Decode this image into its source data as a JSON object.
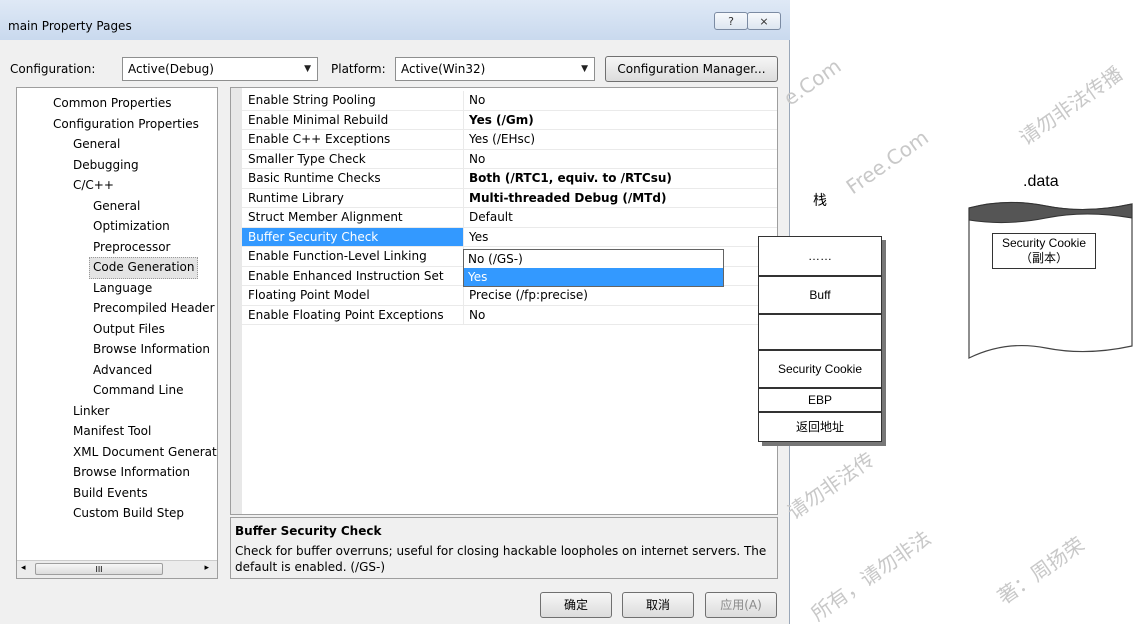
{
  "window": {
    "title": "main Property Pages",
    "help_glyph": "?",
    "close_glyph": "⨯"
  },
  "config": {
    "configuration_label": "Configuration:",
    "configuration_value": "Active(Debug)",
    "platform_label": "Platform:",
    "platform_value": "Active(Win32)",
    "manager_button": "Configuration Manager...",
    "arrow_glyph": "▼"
  },
  "tree": [
    {
      "label": "Common Properties",
      "indent": 0
    },
    {
      "label": "Configuration Properties",
      "indent": 0
    },
    {
      "label": "General",
      "indent": 1
    },
    {
      "label": "Debugging",
      "indent": 1
    },
    {
      "label": "C/C++",
      "indent": 1
    },
    {
      "label": "General",
      "indent": 2
    },
    {
      "label": "Optimization",
      "indent": 2
    },
    {
      "label": "Preprocessor",
      "indent": 2
    },
    {
      "label": "Code Generation",
      "indent": 2,
      "selected": true
    },
    {
      "label": "Language",
      "indent": 2
    },
    {
      "label": "Precompiled Header",
      "indent": 2
    },
    {
      "label": "Output Files",
      "indent": 2
    },
    {
      "label": "Browse Information",
      "indent": 2
    },
    {
      "label": "Advanced",
      "indent": 2
    },
    {
      "label": "Command Line",
      "indent": 2
    },
    {
      "label": "Linker",
      "indent": 1
    },
    {
      "label": "Manifest Tool",
      "indent": 1
    },
    {
      "label": "XML Document Generat",
      "indent": 1
    },
    {
      "label": "Browse Information",
      "indent": 1
    },
    {
      "label": "Build Events",
      "indent": 1
    },
    {
      "label": "Custom Build Step",
      "indent": 1
    }
  ],
  "scrollbar": {
    "left": "◂",
    "right": "▸",
    "thumb": "III"
  },
  "properties": [
    {
      "name": "Enable String Pooling",
      "value": "No",
      "bold": false
    },
    {
      "name": "Enable Minimal Rebuild",
      "value": "Yes (/Gm)",
      "bold": true
    },
    {
      "name": "Enable C++ Exceptions",
      "value": "Yes (/EHsc)",
      "bold": false
    },
    {
      "name": "Smaller Type Check",
      "value": "No",
      "bold": false
    },
    {
      "name": "Basic Runtime Checks",
      "value": "Both (/RTC1, equiv. to /RTCsu)",
      "bold": true
    },
    {
      "name": "Runtime Library",
      "value": "Multi-threaded Debug (/MTd)",
      "bold": true
    },
    {
      "name": "Struct Member Alignment",
      "value": "Default",
      "bold": false
    },
    {
      "name": "Buffer Security Check",
      "value": "Yes",
      "bold": false,
      "selected": true
    },
    {
      "name": "Enable Function-Level Linking",
      "value": "",
      "bold": false
    },
    {
      "name": "Enable Enhanced Instruction Set",
      "value": "",
      "bold": false
    },
    {
      "name": "Floating Point Model",
      "value": "Precise (/fp:precise)",
      "bold": false
    },
    {
      "name": "Enable Floating Point Exceptions",
      "value": "No",
      "bold": false
    }
  ],
  "dropdown": [
    {
      "label": "No (/GS-)",
      "highlighted": false
    },
    {
      "label": "Yes",
      "highlighted": true
    }
  ],
  "description": {
    "title": "Buffer Security Check",
    "text": "Check for buffer overruns; useful for closing hackable loopholes on internet servers.  The default is enabled.    (/GS-)"
  },
  "buttons": {
    "ok": "确定",
    "cancel": "取消",
    "apply": "应用(A)"
  },
  "diagram": {
    "stack_title": "栈",
    "stack_cells": [
      "……",
      "Buff",
      "",
      "Security Cookie",
      "EBP",
      "返回地址"
    ],
    "data_title": ".data",
    "cookie_copy_line1": "Security Cookie",
    "cookie_copy_line2": "（副本）"
  },
  "watermarks": [
    "Free.Com",
    "e.Com",
    "请勿非法传播",
    "请勿非法传",
    "所有，请勿非法",
    "著：周扬荣"
  ]
}
